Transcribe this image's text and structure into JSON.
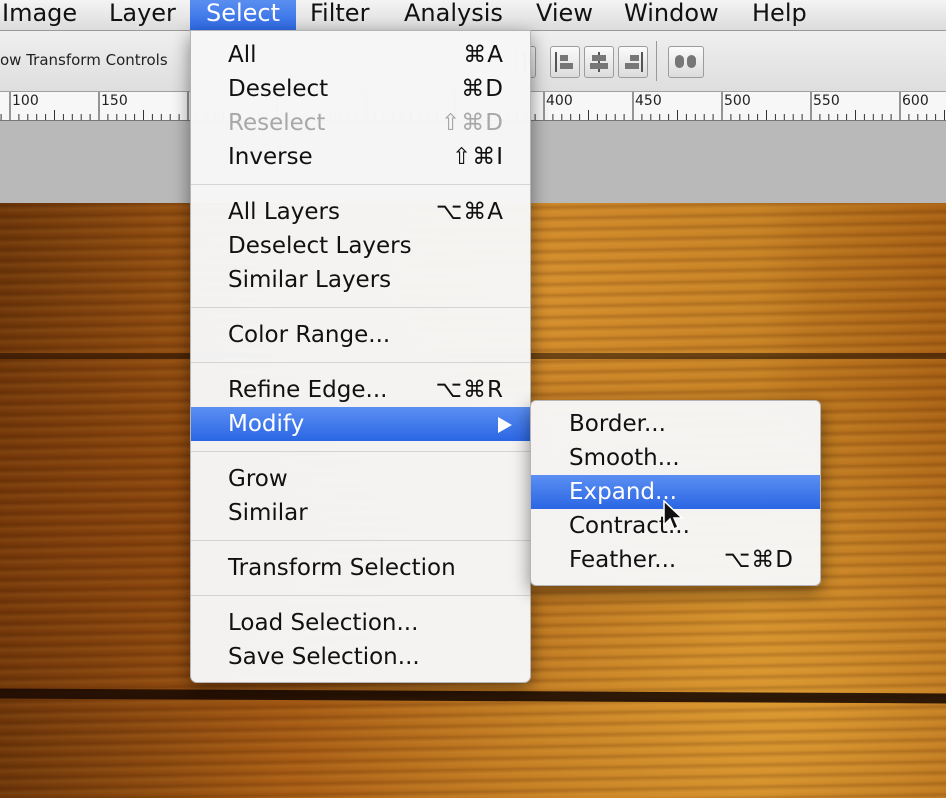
{
  "menubar": {
    "items": [
      "Image",
      "Layer",
      "Select",
      "Filter",
      "Analysis",
      "View",
      "Window",
      "Help"
    ],
    "active": "Select"
  },
  "options_bar": {
    "show_transform_label": "ow Transform Controls"
  },
  "ruler": {
    "labels": [
      "100",
      "150",
      "400",
      "450",
      "500",
      "550",
      "600"
    ]
  },
  "select_menu": {
    "items": [
      {
        "label": "All",
        "shortcut": "⌘A"
      },
      {
        "label": "Deselect",
        "shortcut": "⌘D"
      },
      {
        "label": "Reselect",
        "shortcut": "⇧⌘D",
        "disabled": true
      },
      {
        "label": "Inverse",
        "shortcut": "⇧⌘I"
      },
      {
        "label": "All Layers",
        "shortcut": "⌥⌘A"
      },
      {
        "label": "Deselect Layers",
        "shortcut": ""
      },
      {
        "label": "Similar Layers",
        "shortcut": ""
      },
      {
        "label": "Color Range...",
        "shortcut": ""
      },
      {
        "label": "Refine Edge...",
        "shortcut": "⌥⌘R"
      },
      {
        "label": "Modify",
        "shortcut": "",
        "submenu": true,
        "highlighted": true
      },
      {
        "label": "Grow",
        "shortcut": ""
      },
      {
        "label": "Similar",
        "shortcut": ""
      },
      {
        "label": "Transform Selection",
        "shortcut": ""
      },
      {
        "label": "Load Selection...",
        "shortcut": ""
      },
      {
        "label": "Save Selection...",
        "shortcut": ""
      }
    ]
  },
  "modify_submenu": {
    "items": [
      {
        "label": "Border...",
        "shortcut": ""
      },
      {
        "label": "Smooth...",
        "shortcut": ""
      },
      {
        "label": "Expand...",
        "shortcut": "",
        "highlighted": true
      },
      {
        "label": "Contract...",
        "shortcut": ""
      },
      {
        "label": "Feather...",
        "shortcut": "⌥⌘D"
      }
    ]
  },
  "colors": {
    "highlight": "#2f6ae6",
    "wood": "#b8701c"
  }
}
